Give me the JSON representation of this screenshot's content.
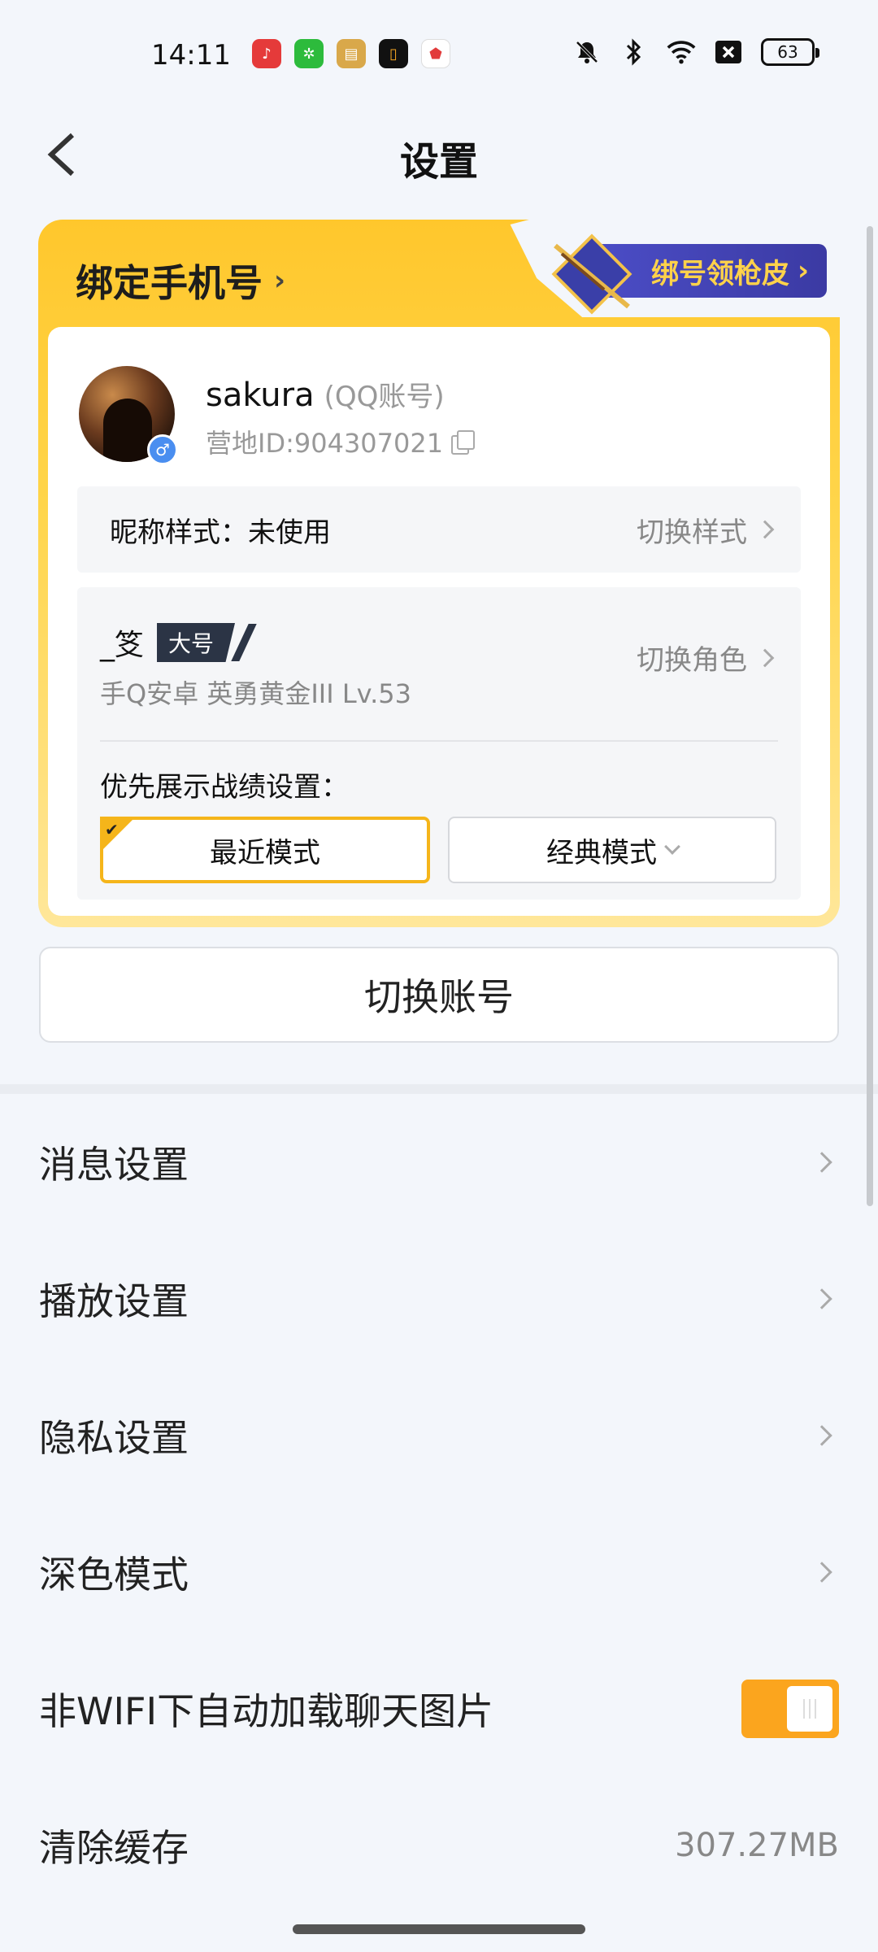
{
  "status_bar": {
    "time": "14:11",
    "battery": "63",
    "apps": [
      {
        "icon": "music-app-icon",
        "color": "#e53a3a"
      },
      {
        "icon": "game-app-icon",
        "color": "#2dbb3c"
      },
      {
        "icon": "game-center-app-icon",
        "color": "#d9a84a"
      },
      {
        "icon": "o-app-icon",
        "color": "#111111"
      },
      {
        "icon": "shield-app-icon",
        "color": "#e23b3b"
      }
    ]
  },
  "header": {
    "title": "设置"
  },
  "card": {
    "bind_phone": "绑定手机号",
    "promo": "绑号领枪皮",
    "username": "sakura",
    "account_type": "(QQ账号)",
    "camp_id": "营地ID:904307021",
    "nick_style_label": "昵称样式：未使用",
    "nick_style_action": "切换样式",
    "role_name": "_笅",
    "role_tag": "大号",
    "role_meta": "手Q安卓  英勇黄金III  Lv.53",
    "role_action": "切换角色",
    "pref_label": "优先展示战绩设置：",
    "mode_recent": "最近模式",
    "mode_classic": "经典模式"
  },
  "switch_account": "切换账号",
  "menu": [
    {
      "label": "消息设置",
      "type": "link"
    },
    {
      "label": "播放设置",
      "type": "link"
    },
    {
      "label": "隐私设置",
      "type": "link"
    },
    {
      "label": "深色模式",
      "type": "link"
    },
    {
      "label": "非WIFI下自动加载聊天图片",
      "type": "toggle",
      "on": true
    },
    {
      "label": "清除缓存",
      "type": "value",
      "value": "307.27MB"
    }
  ],
  "colors": {
    "accent": "#fba51e",
    "banner_yellow": "#ffc72c",
    "promo_blue": "#4c4ec8"
  }
}
